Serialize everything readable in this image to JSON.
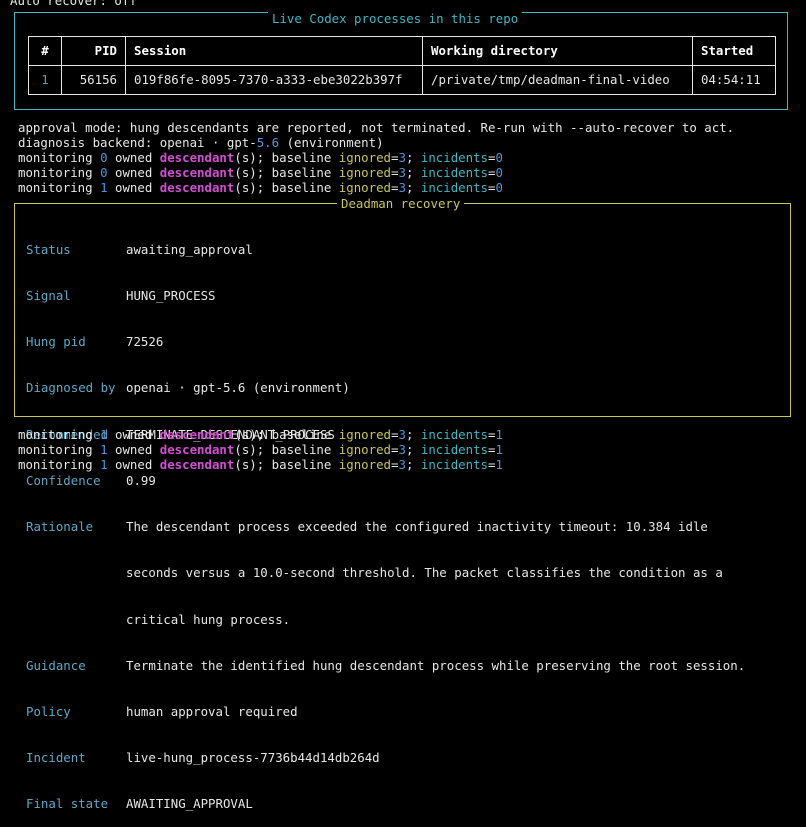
{
  "top_line": "Auto recover: off",
  "codex_panel": {
    "title": "Live Codex processes in this repo",
    "headers": [
      "#",
      "PID",
      "Session",
      "Working directory",
      "Started"
    ],
    "rows": [
      {
        "num": "1",
        "pid": "56156",
        "session": "019f86fe-8095-7370-a333-ebe3022b397f",
        "dir": "/private/tmp/deadman-final-video",
        "started": "04:54:11"
      }
    ]
  },
  "approval_line": "approval mode: hung descendants are reported, not terminated. Re-run with --auto-recover to act.",
  "diag": {
    "prefix": "diagnosis backend: openai · gpt-",
    "version": "5.6",
    "suffix": " (environment)"
  },
  "monitor_words": {
    "w1": "monitoring ",
    "w2": " owned ",
    "desc": "descendant",
    "w3": "(s); baseline ",
    "ignored": "ignored",
    "w4": "=",
    "w5": "; ",
    "incidents": "incidents",
    "eq": "="
  },
  "monitor_before": [
    {
      "count": "0",
      "ignored_val": "3",
      "incidents_val": "0"
    },
    {
      "count": "0",
      "ignored_val": "3",
      "incidents_val": "0"
    },
    {
      "count": "1",
      "ignored_val": "3",
      "incidents_val": "0"
    }
  ],
  "recovery": {
    "title": "Deadman recovery",
    "fields": [
      {
        "label": "Status",
        "value": "awaiting_approval"
      },
      {
        "label": "Signal",
        "value": "HUNG_PROCESS"
      },
      {
        "label": "Hung pid",
        "value": "72526"
      },
      {
        "label": "Diagnosed by",
        "value": "openai · gpt-5.6 (environment)"
      },
      {
        "label": "Recommended",
        "value": "TERMINATE_DESCENDANT_PROCESS"
      },
      {
        "label": "Confidence",
        "value": "0.99"
      },
      {
        "label": "Rationale",
        "value": "The descendant process exceeded the configured inactivity timeout: 10.384 idle"
      },
      {
        "label": "",
        "value": "seconds versus a 10.0-second threshold. The packet classifies the condition as a"
      },
      {
        "label": "",
        "value": "critical hung process."
      },
      {
        "label": "Guidance",
        "value": "Terminate the identified hung descendant process while preserving the root session."
      },
      {
        "label": "Policy",
        "value": "human approval required"
      },
      {
        "label": "Incident",
        "value": "live-hung_process-7736b44d14db264d"
      },
      {
        "label": "Final state",
        "value": "AWAITING_APPROVAL"
      }
    ]
  },
  "monitor_after": [
    {
      "count": "1",
      "ignored_val": "3",
      "incidents_val": "1"
    },
    {
      "count": "1",
      "ignored_val": "3",
      "incidents_val": "1"
    },
    {
      "count": "1",
      "ignored_val": "3",
      "incidents_val": "1"
    }
  ],
  "colors": {
    "cyan_border": "#3fb6c2",
    "yellow_border": "#c9c45c",
    "magenta": "#d14fd1",
    "label_blue": "#5ea6c8"
  }
}
